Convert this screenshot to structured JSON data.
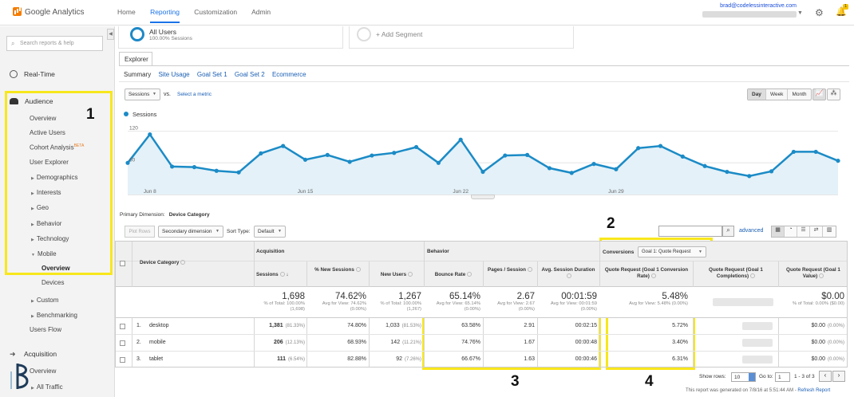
{
  "app": {
    "brand": "Google Analytics"
  },
  "topnav": {
    "home": "Home",
    "reporting": "Reporting",
    "customization": "Customization",
    "admin": "Admin"
  },
  "account": {
    "email": "brad@codelessinteractive.com"
  },
  "notifications": {
    "count": "1"
  },
  "sidebar": {
    "search_placeholder": "Search reports & help",
    "realtime": "Real-Time",
    "audience": "Audience",
    "items": {
      "overview": "Overview",
      "active_users": "Active Users",
      "cohort": "Cohort Analysis",
      "cohort_badge": "BETA",
      "user_explorer": "User Explorer",
      "demographics": "Demographics",
      "interests": "Interests",
      "geo": "Geo",
      "behavior": "Behavior",
      "technology": "Technology",
      "mobile": "Mobile",
      "mobile_overview": "Overview",
      "devices": "Devices",
      "custom": "Custom",
      "benchmarking": "Benchmarking",
      "users_flow": "Users Flow"
    },
    "acquisition": "Acquisition",
    "acq_overview": "Overview",
    "all_traffic": "All Traffic"
  },
  "segments": {
    "all_users": "All Users",
    "all_users_sub": "100.00% Sessions",
    "add": "+ Add Segment"
  },
  "explorer": {
    "tab": "Explorer",
    "subtabs": [
      "Summary",
      "Site Usage",
      "Goal Set 1",
      "Goal Set 2",
      "Ecommerce"
    ]
  },
  "controls": {
    "metric": "Sessions",
    "vs": "vs.",
    "select_metric": "Select a metric",
    "day": "Day",
    "week": "Week",
    "month": "Month"
  },
  "chart_data": {
    "type": "line",
    "series": [
      {
        "name": "Sessions",
        "color": "#1b8bc6",
        "values": [
          60,
          114,
          53,
          52,
          45,
          42,
          78,
          92,
          66,
          75,
          62,
          74,
          79,
          90,
          60,
          104,
          43,
          74,
          75,
          50,
          41,
          58,
          48,
          88,
          92,
          72,
          54,
          43,
          35,
          44,
          81,
          81,
          64
        ]
      }
    ],
    "x_ticks": [
      "Jun 8",
      "Jun 15",
      "Jun 22",
      "Jun 29"
    ],
    "y_ticks": [
      "120",
      "60"
    ],
    "ylim": [
      0,
      130
    ],
    "grid": true,
    "area_fill": true
  },
  "table": {
    "primary_dimension_label": "Primary Dimension:",
    "primary_dimension": "Device Category",
    "plot_rows": "Plot Rows",
    "secondary_dimension": "Secondary dimension",
    "sort_type_label": "Sort Type:",
    "sort_type": "Default",
    "advanced": "advanced",
    "group_acquisition": "Acquisition",
    "group_behavior": "Behavior",
    "conversions_label": "Conversions",
    "goal_select": "Goal 1: Quote Request",
    "headers": {
      "device": "Device Category",
      "sessions": "Sessions",
      "new_sessions": "% New Sessions",
      "new_users": "New Users",
      "bounce": "Bounce Rate",
      "pages": "Pages / Session",
      "duration": "Avg. Session Duration",
      "conv_rate": "Quote Request (Goal 1 Conversion Rate)",
      "completions": "Quote Request (Goal 1 Completions)",
      "value": "Quote Request (Goal 1 Value)"
    },
    "totals": {
      "sessions": "1,698",
      "sessions_sub": "% of Total: 100.00% (1,698)",
      "new_sessions": "74.62%",
      "new_sessions_sub": "Avg for View: 74.62% (0.00%)",
      "new_users": "1,267",
      "new_users_sub": "% of Total: 100.00% (1,267)",
      "bounce": "65.14%",
      "bounce_sub": "Avg for View: 65.14% (0.00%)",
      "pages": "2.67",
      "pages_sub": "Avg for View: 2.67 (0.00%)",
      "duration": "00:01:59",
      "duration_sub": "Avg for View: 00:01:59 (0.00%)",
      "conv_rate": "5.48%",
      "conv_rate_sub": "Avg for View: 5.48% (0.00%)",
      "value": "$0.00",
      "value_sub": "% of Total: 0.00% ($0.00)"
    },
    "rows": [
      {
        "idx": "1.",
        "device": "desktop",
        "sessions": "1,381",
        "sessions_pct": "(81.33%)",
        "new_sessions": "74.80%",
        "new_users": "1,033",
        "new_users_pct": "(81.53%)",
        "bounce": "63.58%",
        "pages": "2.91",
        "duration": "00:02:15",
        "conv_rate": "5.72%",
        "value": "$0.00",
        "value_pct": "(0.00%)"
      },
      {
        "idx": "2.",
        "device": "mobile",
        "sessions": "206",
        "sessions_pct": "(12.13%)",
        "new_sessions": "68.93%",
        "new_users": "142",
        "new_users_pct": "(11.21%)",
        "bounce": "74.76%",
        "pages": "1.67",
        "duration": "00:00:48",
        "conv_rate": "3.40%",
        "value": "$0.00",
        "value_pct": "(0.00%)"
      },
      {
        "idx": "3.",
        "device": "tablet",
        "sessions": "111",
        "sessions_pct": "(6.54%)",
        "new_sessions": "82.88%",
        "new_users": "92",
        "new_users_pct": "(7.26%)",
        "bounce": "66.67%",
        "pages": "1.63",
        "duration": "00:00:46",
        "conv_rate": "6.31%",
        "value": "$0.00",
        "value_pct": "(0.00%)"
      }
    ],
    "pager": {
      "show_rows_label": "Show rows:",
      "show_rows": "10",
      "goto_label": "Go to:",
      "goto": "1",
      "range": "1 - 3 of 3"
    },
    "footer": {
      "text": "This report was generated on 7/8/16 at 5:51:44 AM -",
      "refresh": "Refresh Report"
    }
  },
  "annotations": {
    "n1": "1",
    "n2": "2",
    "n3": "3",
    "n4": "4",
    "highlight_color": "#f8e71c"
  }
}
